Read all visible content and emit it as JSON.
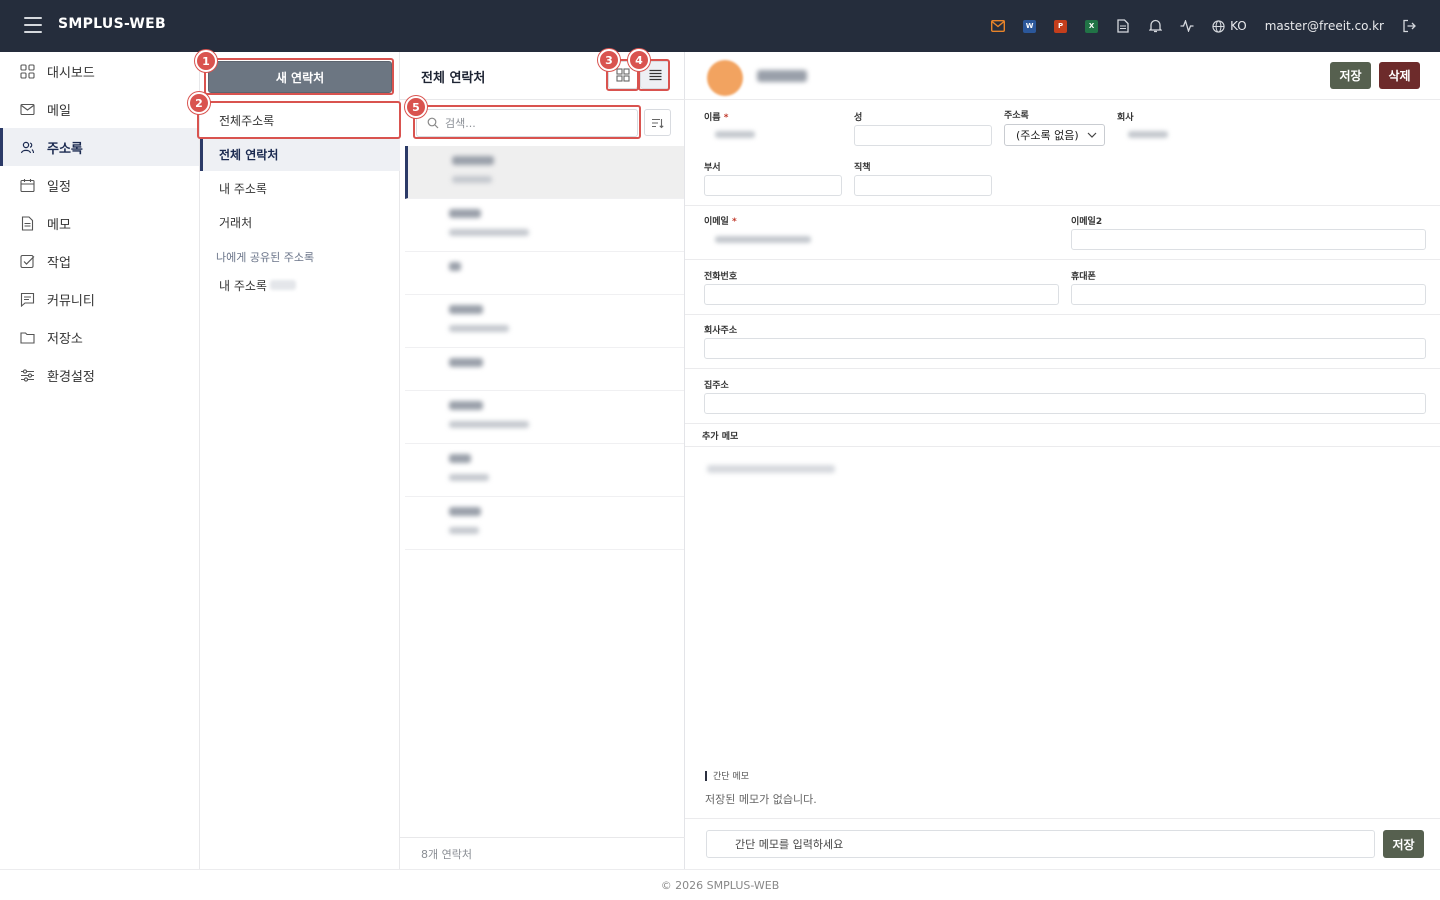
{
  "app": {
    "brand": "SMPLUS-WEB",
    "language": "KO",
    "user_email": "master@freeit.co.kr"
  },
  "topbar_icons": [
    {
      "name": "mail-icon",
      "color": "#e8842a"
    },
    {
      "name": "word-icon",
      "letter": "W",
      "color": "#2b579a"
    },
    {
      "name": "powerpoint-icon",
      "letter": "P",
      "color": "#c43e1c"
    },
    {
      "name": "excel-icon",
      "letter": "X",
      "color": "#217346"
    },
    {
      "name": "document-icon"
    },
    {
      "name": "bell-icon"
    },
    {
      "name": "activity-icon"
    },
    {
      "name": "globe-icon"
    },
    {
      "name": "logout-icon"
    }
  ],
  "sidebar": {
    "items": [
      {
        "label": "대시보드",
        "icon": "dashboard-icon"
      },
      {
        "label": "메일",
        "icon": "mail-icon"
      },
      {
        "label": "주소록",
        "icon": "contacts-icon",
        "active": true
      },
      {
        "label": "일정",
        "icon": "calendar-icon"
      },
      {
        "label": "메모",
        "icon": "memo-icon"
      },
      {
        "label": "작업",
        "icon": "task-icon"
      },
      {
        "label": "커뮤니티",
        "icon": "community-icon"
      },
      {
        "label": "저장소",
        "icon": "folder-icon"
      },
      {
        "label": "환경설정",
        "icon": "settings-icon"
      }
    ]
  },
  "addressbook": {
    "new_contact": "새 연락처",
    "all_addressbooks": "전체주소록",
    "all_contacts": "전체 연락처",
    "my_addressbook": "내 주소록",
    "clients": "거래처",
    "shared_section": "나에게 공유된 주소록",
    "shared_item": "내 주소록"
  },
  "contact_list": {
    "title": "전체 연락처",
    "search_placeholder": "검색...",
    "footer": "8개 연락처"
  },
  "detail": {
    "save": "저장",
    "delete": "삭제",
    "labels": {
      "name": "이름",
      "surname": "성",
      "addressbook": "주소록",
      "company": "회사",
      "department": "부서",
      "position": "직책",
      "email": "이메일",
      "email2": "이메일2",
      "phone": "전화번호",
      "mobile": "휴대폰",
      "company_address": "회사주소",
      "home_address": "집주소",
      "extra_memo": "추가 메모"
    },
    "required_mark": "*",
    "addressbook_value": "(주소록 없음)",
    "quick_memo_title": "간단 메모",
    "quick_memo_empty": "저장된 메모가 없습니다.",
    "quick_memo_placeholder": "간단 메모를 입력하세요",
    "quick_memo_save": "저장"
  },
  "annotations": [
    "1",
    "2",
    "3",
    "4",
    "5"
  ],
  "footer": {
    "copyright": "© 2026 SMPLUS-WEB"
  },
  "colors": {
    "topbar": "#252d3c",
    "accent": "#2b3a67",
    "save": "#56604f",
    "delete": "#6d2b2b",
    "highlight": "#d9534f"
  }
}
